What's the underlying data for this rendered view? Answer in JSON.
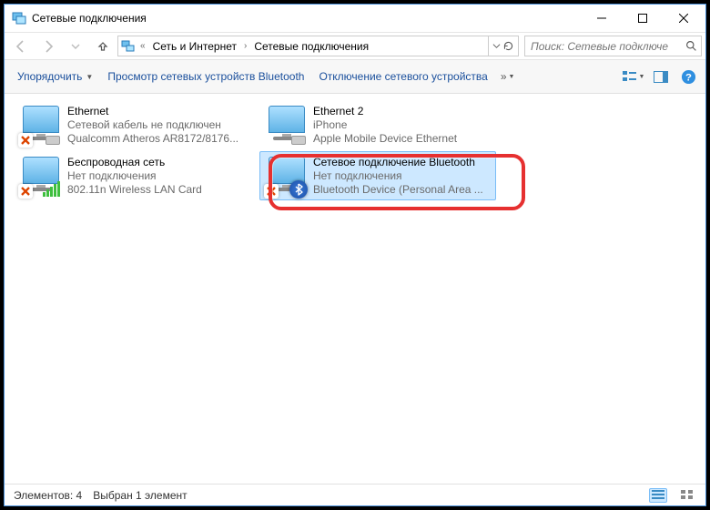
{
  "title": "Сетевые подключения",
  "breadcrumb": {
    "root_sep": "«",
    "item1": "Сеть и Интернет",
    "item2": "Сетевые подключения"
  },
  "search": {
    "placeholder": "Поиск: Сетевые подключе"
  },
  "toolbar": {
    "organize": "Упорядочить",
    "view_bt": "Просмотр сетевых устройств Bluetooth",
    "disable": "Отключение сетевого устройства",
    "more": "»"
  },
  "connections": [
    {
      "name": "Ethernet",
      "status": "Сетевой кабель не подключен",
      "device": "Qualcomm Atheros AR8172/8176...",
      "kind": "eth"
    },
    {
      "name": "Ethernet 2",
      "status": "iPhone",
      "device": "Apple Mobile Device Ethernet",
      "kind": "eth2"
    },
    {
      "name": "Беспроводная сеть",
      "status": "Нет подключения",
      "device": "802.11n Wireless LAN Card",
      "kind": "wifi"
    },
    {
      "name": "Сетевое подключение Bluetooth",
      "status": "Нет подключения",
      "device": "Bluetooth Device (Personal Area ...",
      "kind": "bt",
      "selected": true
    }
  ],
  "statusbar": {
    "count": "Элементов: 4",
    "selection": "Выбран 1 элемент"
  }
}
